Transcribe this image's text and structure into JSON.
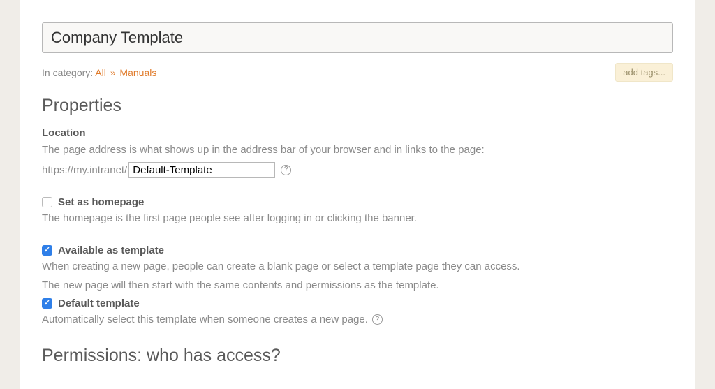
{
  "title": {
    "value": "Company Template"
  },
  "category": {
    "label": "In category:",
    "all": "All",
    "sep": "»",
    "manuals": "Manuals"
  },
  "addTags": "add tags...",
  "propertiesHeading": "Properties",
  "location": {
    "label": "Location",
    "desc": "The page address is what shows up in the address bar of your browser and in links to the page:",
    "urlPrefix": "https://my.intranet/",
    "slug": "Default-Template"
  },
  "homepage": {
    "checked": false,
    "label": "Set as homepage",
    "desc": "The homepage is the first page people see after logging in or clicking the banner."
  },
  "template": {
    "checked": true,
    "label": "Available as template",
    "desc1": "When creating a new page, people can create a blank page or select a template page they can access.",
    "desc2": "The new page will then start with the same contents and permissions as the template."
  },
  "defaultTemplate": {
    "checked": true,
    "label": "Default template",
    "desc": "Automatically select this template when someone creates a new page."
  },
  "permissionsHeading": "Permissions: who has access?"
}
